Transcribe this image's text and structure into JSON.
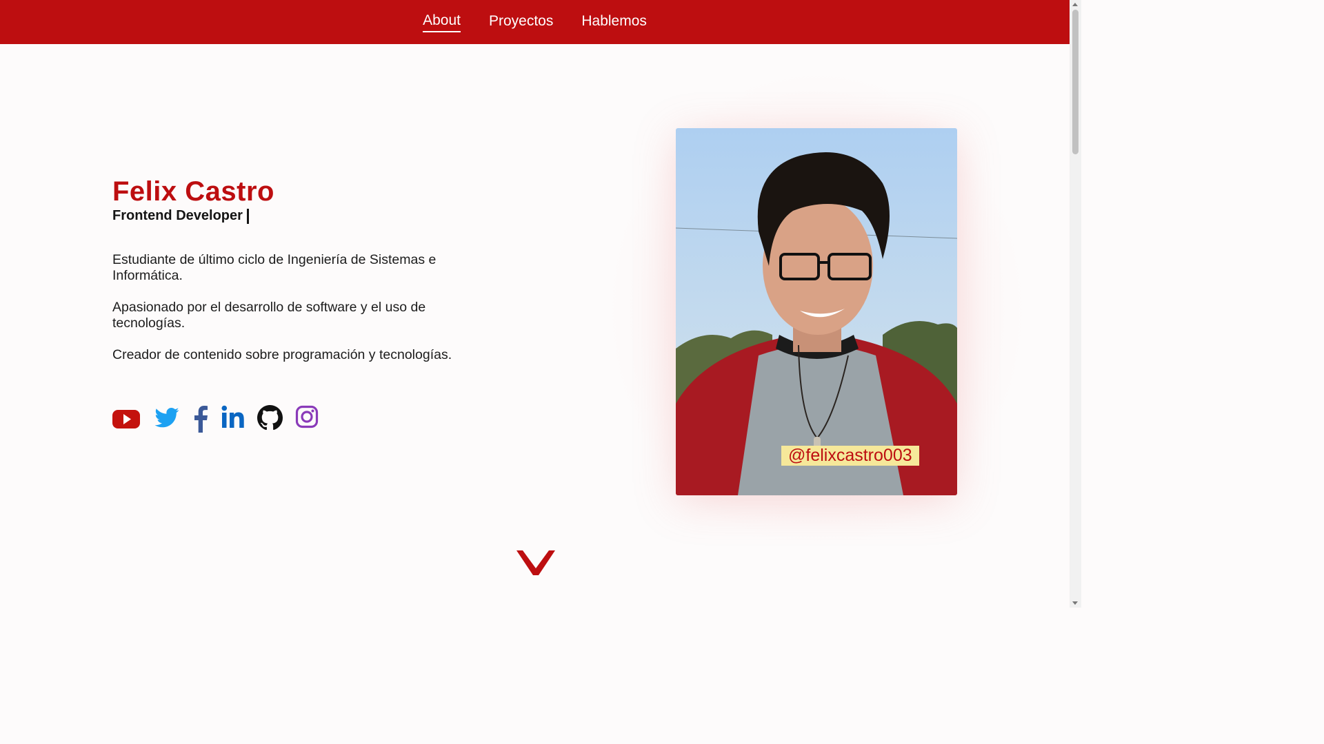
{
  "nav": {
    "items": [
      {
        "label": "About",
        "active": true
      },
      {
        "label": "Proyectos",
        "active": false
      },
      {
        "label": "Hablemos",
        "active": false
      }
    ]
  },
  "hero": {
    "name": "Felix Castro",
    "role": "Frontend Developer",
    "paragraphs": [
      "Estudiante de último ciclo de Ingeniería de Sistemas e Informática.",
      "Apasionado por el desarrollo de software y el uso de tecnologías.",
      "Creador de contenido sobre programación y tecnologías."
    ],
    "handle": "@felixcastro003"
  },
  "socials": [
    {
      "icon": "youtube-icon",
      "color": "#c4120d"
    },
    {
      "icon": "twitter-icon",
      "color": "#1da1f2"
    },
    {
      "icon": "facebook-icon",
      "color": "#3b5998"
    },
    {
      "icon": "linkedin-icon",
      "color": "#0a66c2"
    },
    {
      "icon": "github-icon",
      "color": "#111111"
    },
    {
      "icon": "instagram-icon",
      "color": "#8a3ab9"
    }
  ],
  "colors": {
    "brand": "#bd0e10",
    "handle_bg": "#f6e89a"
  },
  "scroll_icon": "chevron-down-icon"
}
